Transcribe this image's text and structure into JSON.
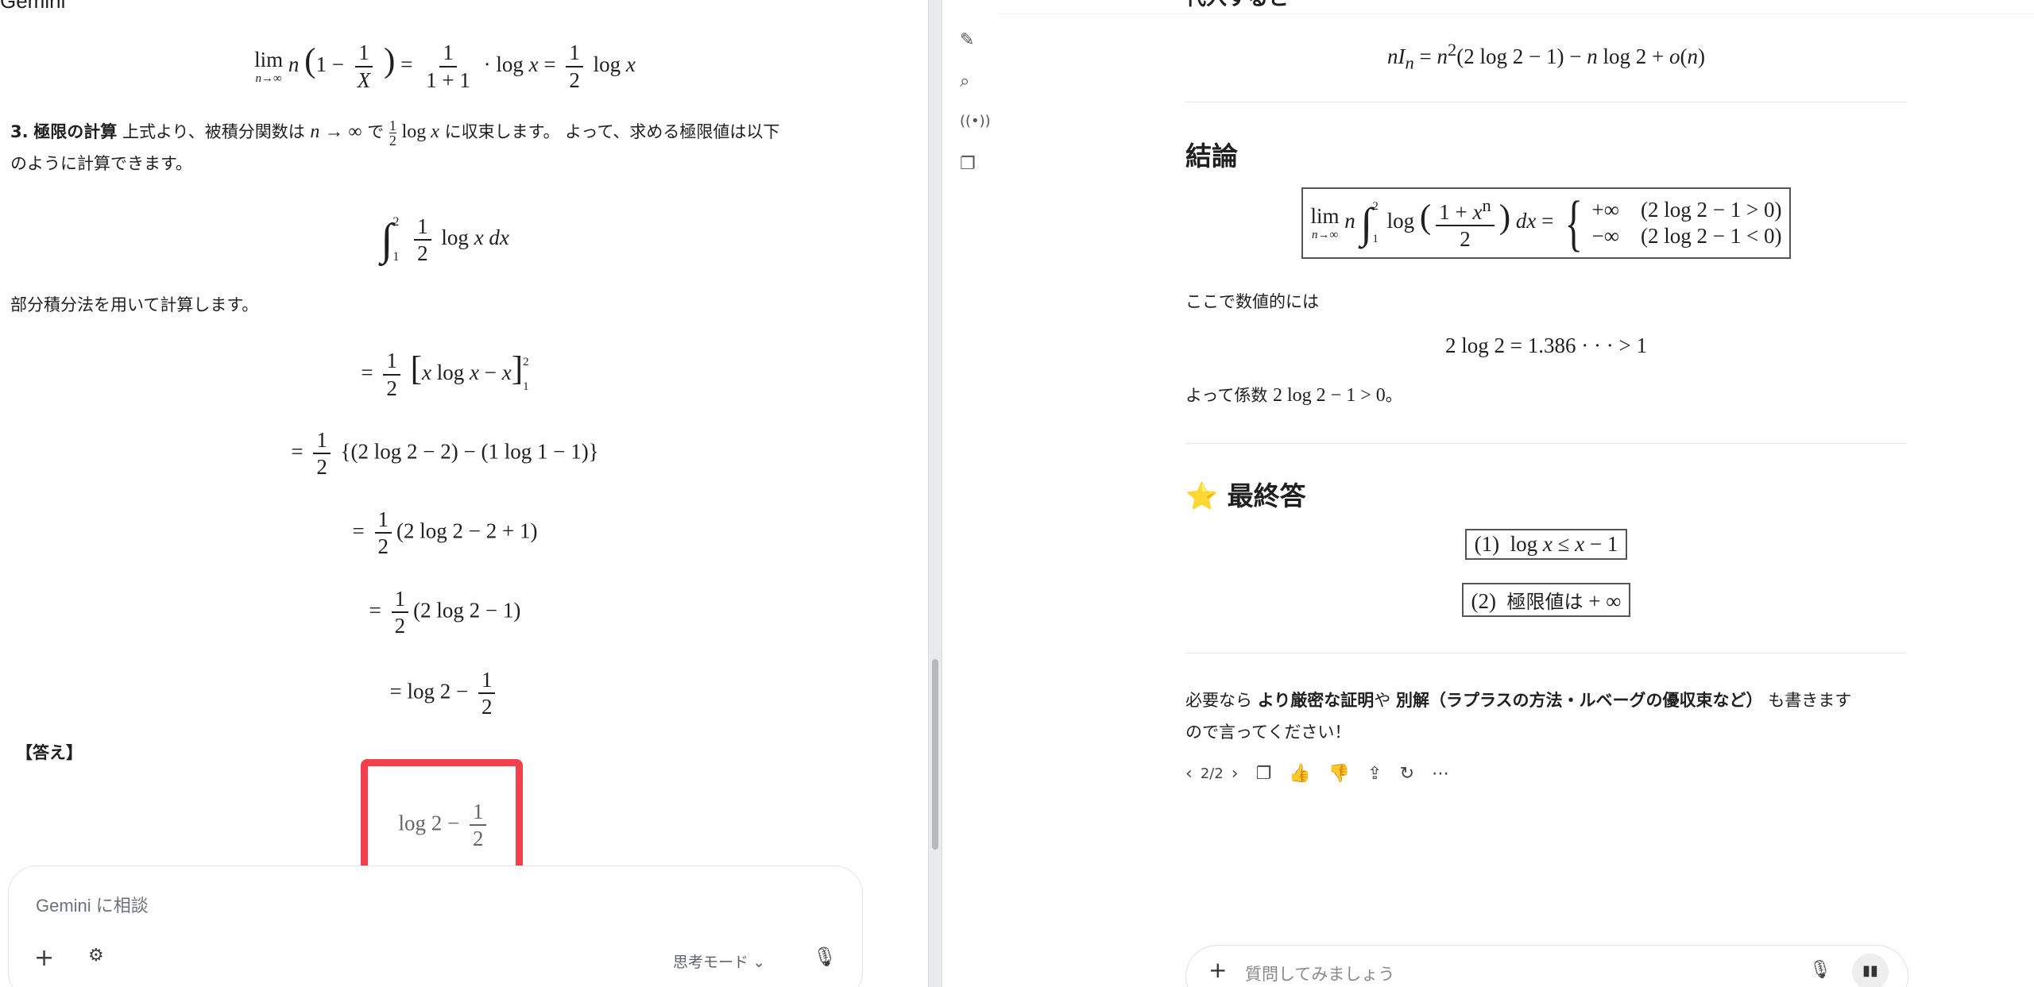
{
  "left": {
    "app_name": "Gemini",
    "step3_num": "3.",
    "step3_heading": "極限の計算",
    "step3_text_a": "上式より、被積分関数は",
    "step3_text_b": "に収束します。 よって、求める極限値は以下",
    "step3_text_c": "のように計算できます。",
    "parts_text": "部分積分法を用いて計算します。",
    "answer_label": "【答え】",
    "composer_placeholder": "Gemini に相談",
    "mode_label": "思考モード",
    "icons": [
      "plus-icon",
      "tune-icon",
      "chevron-down-icon",
      "mic-icon"
    ]
  },
  "toolbar": {
    "icons": [
      "edit-icon",
      "search-icon",
      "broadcast-icon",
      "gallery-icon"
    ]
  },
  "right": {
    "top_partial": "代入すると",
    "conclusion_heading": "結論",
    "numeric_text": "ここで数値的には",
    "coef_text_a": "よって係数",
    "coef_text_b": "。",
    "final_heading": "最終答",
    "final_star": "⭐",
    "answer2_text": "極限値は",
    "followup_a": "必要なら",
    "followup_b1": "より厳密な証明",
    "followup_c": "や",
    "followup_b2": "別解（ラプラスの方法・ルベーグの優収束など）",
    "followup_d": "も書きます",
    "followup_e": "ので言ってください！",
    "pager": "2/2",
    "composer_placeholder": "質問してみましょう",
    "icons": [
      "chevron-left-icon",
      "chevron-right-icon",
      "copy-icon",
      "thumbs-up-icon",
      "thumbs-down-icon",
      "share-icon",
      "regenerate-icon",
      "more-icon",
      "plus-icon",
      "mic-icon",
      "voice-icon"
    ]
  },
  "colors": {
    "highlight": "#f2404b",
    "divider": "#e9eaec",
    "text": "#1f1f1f"
  }
}
